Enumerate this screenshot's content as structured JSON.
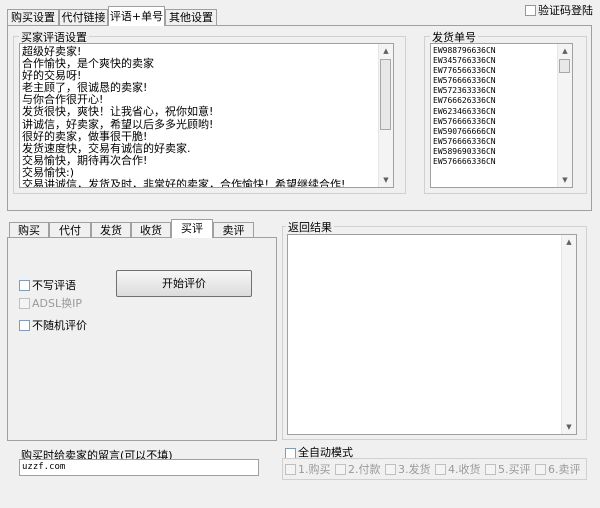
{
  "top_tabs": [
    "购买设置",
    "代付链接",
    "评语+单号",
    "其他设置"
  ],
  "verify_login_label": "验证码登陆",
  "comments_group": {
    "label": "买家评语设置",
    "lines": [
      "超级好卖家!",
      "合作愉快，是个爽快的卖家",
      "好的交易呀!",
      "老主顾了，很诚恳的卖家!",
      "与你合作很开心!",
      "发货很快，爽快！让我省心，祝你如意!",
      "讲诚信，好卖家，希望以后多多光顾哟!",
      "很好的卖家，做事很干脆!",
      "发货速度快，交易有诚信的好卖家.",
      "交易愉快，期待再次合作!",
      "交易愉快:)",
      "交易讲诚信，发货及时，非常好的卖家，合作愉快！希望继续合作!"
    ]
  },
  "orders_group": {
    "label": "发货单号",
    "lines": [
      "EW988796636CN",
      "EW345766336CN",
      "EW776566336CN",
      "EW576666336CN",
      "EW572363336CN",
      "EW766626336CN",
      "EW623466336CN",
      "EW576666336CN",
      "EW590766666CN",
      "EW576666336CN",
      "EW589690336CN",
      "EW576666336CN"
    ]
  },
  "sub_tabs": [
    "购买",
    "代付",
    "发货",
    "收货",
    "买评",
    "卖评"
  ],
  "buyer_review": {
    "no_review_label": "不写评语",
    "adsl_label": "ADSL换IP",
    "no_random_label": "不随机评价",
    "start_button": "开始评价"
  },
  "message": {
    "label": "购买时给卖家的留言(可以不填)",
    "value": "uzzf.com"
  },
  "result_label": "返回结果",
  "auto_mode": {
    "label": "全自动模式",
    "steps": [
      "1.购买",
      "2.付款",
      "3.发货",
      "4.收货",
      "5.买评",
      "6.卖评"
    ]
  }
}
